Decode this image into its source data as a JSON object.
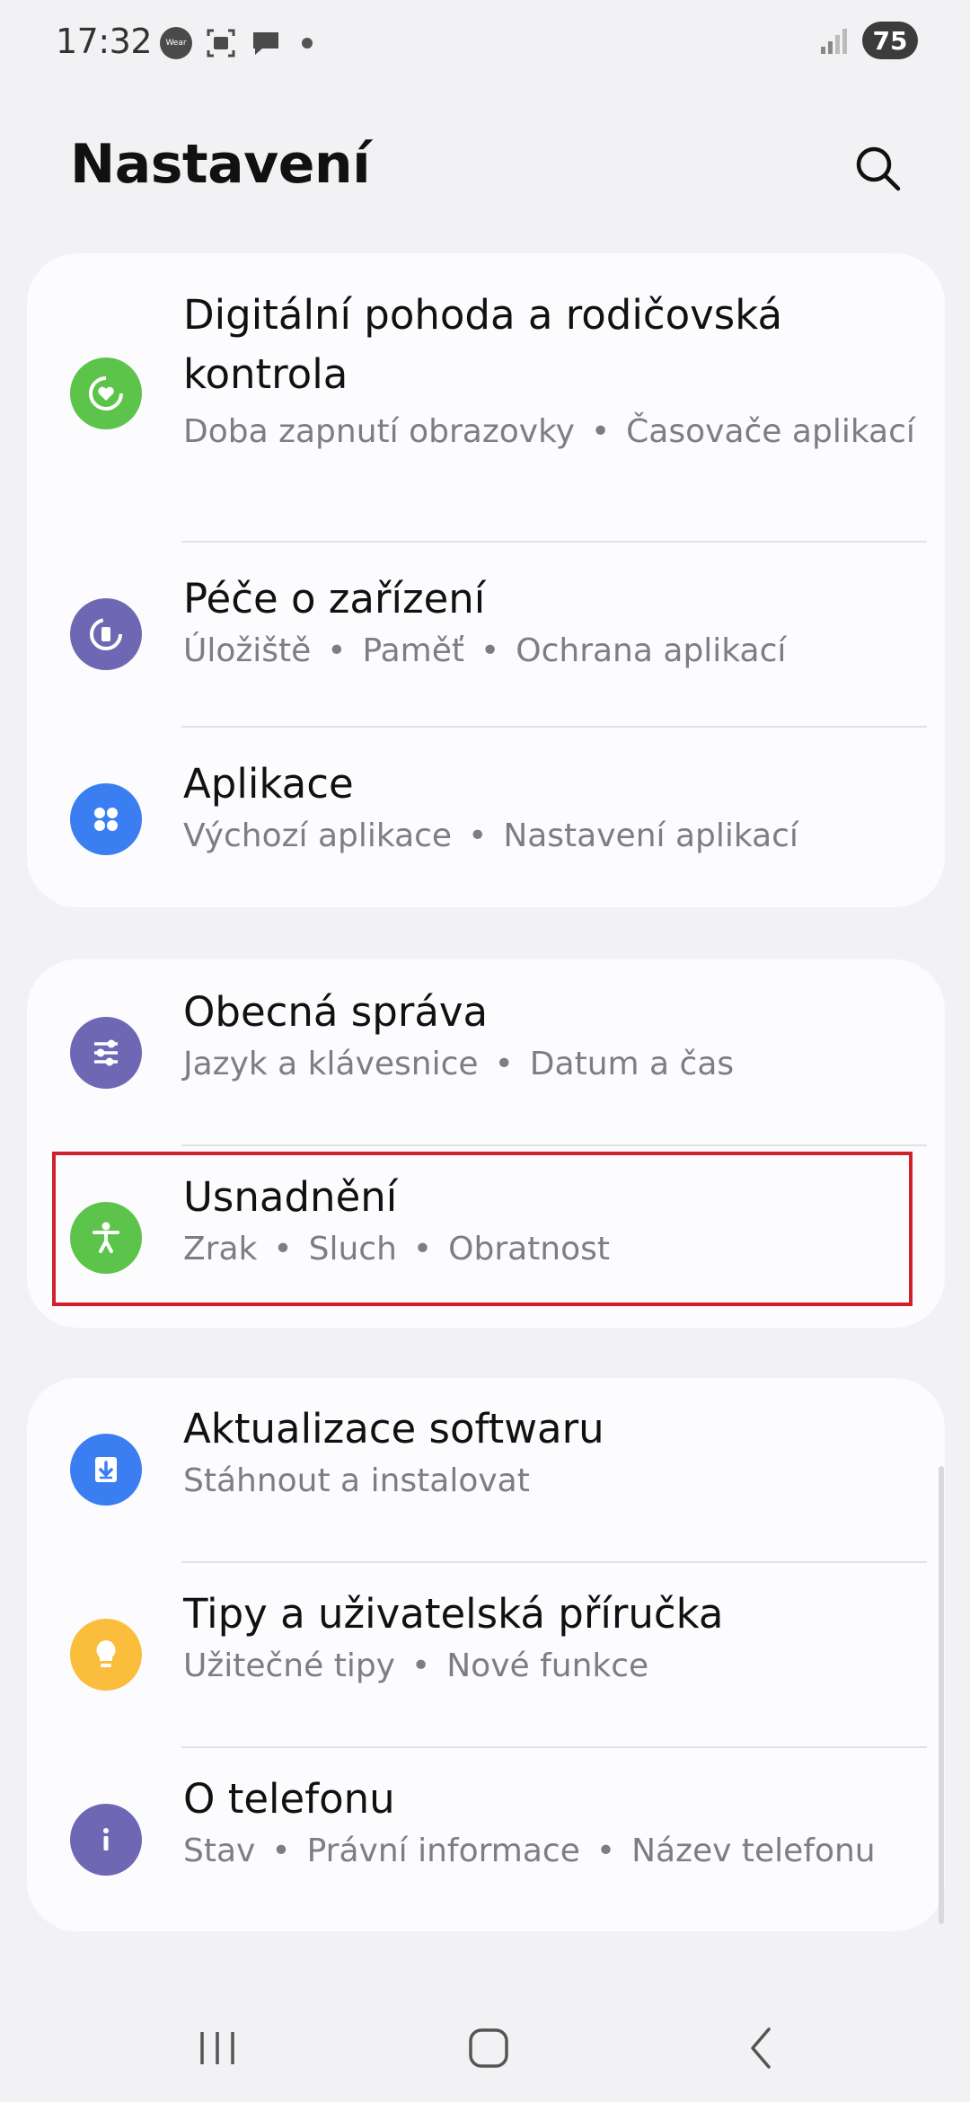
{
  "status_bar": {
    "time": "17:32",
    "wear_label": "Wear",
    "battery": "75"
  },
  "header": {
    "title": "Nastavení"
  },
  "groups": [
    {
      "items": [
        {
          "title": "Digitální pohoda a rodičovská kontrola",
          "subtitle_parts": [
            "Doba zapnutí obrazovky",
            "Časovače aplikací"
          ],
          "icon": "digital-wellbeing-icon",
          "color": "#5cc44a"
        },
        {
          "title": "Péče o zařízení",
          "subtitle_parts": [
            "Úložiště",
            "Paměť",
            "Ochrana aplikací"
          ],
          "icon": "device-care-icon",
          "color": "#6e68b4"
        },
        {
          "title": "Aplikace",
          "subtitle_parts": [
            "Výchozí aplikace",
            "Nastavení aplikací"
          ],
          "icon": "apps-icon",
          "color": "#3a7ef2"
        }
      ]
    },
    {
      "items": [
        {
          "title": "Obecná správa",
          "subtitle_parts": [
            "Jazyk a klávesnice",
            "Datum a čas"
          ],
          "icon": "general-management-icon",
          "color": "#6e68b4"
        },
        {
          "title": "Usnadnění",
          "subtitle_parts": [
            "Zrak",
            "Sluch",
            "Obratnost"
          ],
          "icon": "accessibility-icon",
          "color": "#5cc44a"
        }
      ]
    },
    {
      "items": [
        {
          "title": "Aktualizace softwaru",
          "subtitle_parts": [
            "Stáhnout a instalovat"
          ],
          "icon": "software-update-icon",
          "color": "#3a7ef2"
        },
        {
          "title": "Tipy a uživatelská příručka",
          "subtitle_parts": [
            "Užitečné tipy",
            "Nové funkce"
          ],
          "icon": "tips-icon",
          "color": "#fbbd3c"
        },
        {
          "title": "O telefonu",
          "subtitle_parts": [
            "Stav",
            "Právní informace",
            "Název telefonu"
          ],
          "icon": "about-phone-icon",
          "color": "#6e68b4"
        }
      ]
    }
  ],
  "highlight_color": "#d0202a"
}
